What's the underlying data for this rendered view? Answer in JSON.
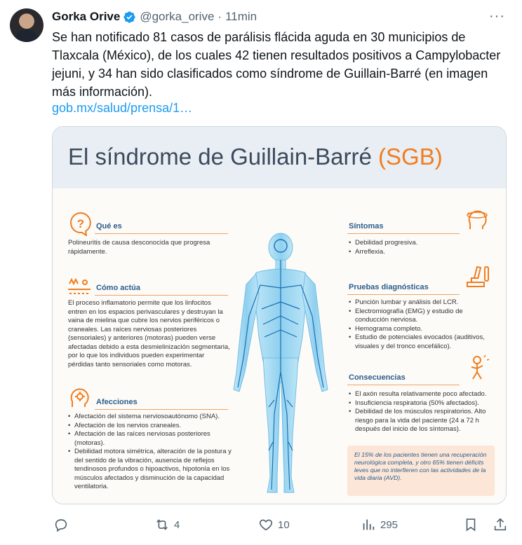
{
  "tweet": {
    "author_name": "Gorka Orive",
    "handle": "@gorka_orive",
    "separator": "·",
    "time": "11min",
    "more": "···",
    "text": "Se han notificado 81 casos de parálisis flácida aguda en 30 municipios de Tlaxcala (México), de los cuales 42 tienen resultados positivos a Campylobacter jejuni, y 34 han sido clasificados como síndrome de Guillain-Barré (en imagen más información).",
    "link": "gob.mx/salud/prensa/1…"
  },
  "infographic": {
    "title_main": "El síndrome de Guillain-Barré ",
    "title_accent": "(SGB)",
    "que_es": {
      "title": "Qué es",
      "text": "Polineuritis de causa desconocida que progresa rápidamente."
    },
    "como_actua": {
      "title": "Cómo actúa",
      "text": "El proceso inflamatorio permite que los linfocitos entren en los espacios perivasculares y destruyan la vaina de mielina que cubre los nervios periféricos o craneales. Las raíces nerviosas posteriores (sensoriales) y anteriores (motoras) pueden verse afectadas debido a esta desmielinización segmentaria, por lo que los individuos pueden experimentar pérdidas tanto sensoriales como motoras."
    },
    "afecciones": {
      "title": "Afecciones",
      "items": [
        "Afectación del sistema nerviosoautónomo (SNA).",
        "Afectación de los nervios craneales.",
        "Afectación de las raíces nerviosas posteriores (motoras).",
        "Debilidad motora simétrica, alteración de la postura y del sentido de la vibración, ausencia de reflejos tendinosos profundos o hipoactivos, hipotonía en los músculos afectados y disminución de la capacidad ventilatoria."
      ]
    },
    "sintomas": {
      "title": "Síntomas",
      "items": [
        "Debilidad progresiva.",
        "Arreflexia."
      ]
    },
    "pruebas": {
      "title": "Pruebas diagnósticas",
      "items": [
        "Punción lumbar y análisis del LCR.",
        "Electromiografía (EMG) y estudio de conducción nerviosa.",
        "Hemograma completo.",
        "Estudio de potenciales evocados (auditivos, visuales y del tronco encefálico)."
      ]
    },
    "consecuencias": {
      "title": "Consecuencias",
      "items": [
        "El axón resulta relativamente poco afectado.",
        "Insuficiencia respiratoria (50% afectados).",
        "Debilidad de los músculos respiratorios. Alto riesgo para la vida del paciente (24 a 72 h después del inicio de los síntomas)."
      ]
    },
    "note": "El 15% de los pacientes tienen una recuperación neurológica completa, y otro 65% tienen déficits leves que no interfieren con las actividades de la vida diaria (AVD)."
  },
  "actions": {
    "retweets": "4",
    "likes": "10",
    "views": "295"
  },
  "colors": {
    "accent_orange": "#f07d1f",
    "title_blue": "#2c5d8a",
    "link_blue": "#1d9bf0",
    "muted": "#536471"
  }
}
